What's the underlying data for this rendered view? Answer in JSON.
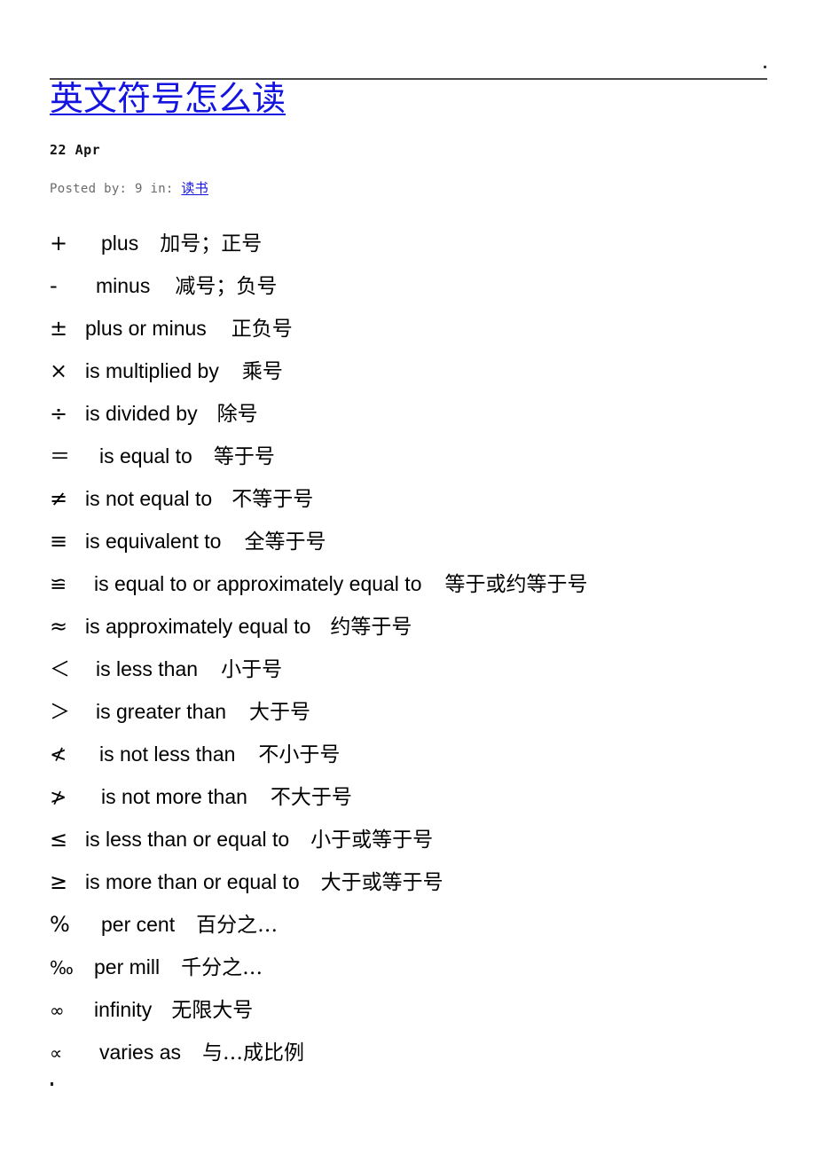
{
  "document": {
    "title": "英文符号怎么读",
    "date": "22 Apr",
    "meta_prefix": "Posted by: 9 in: ",
    "meta_category": "读书",
    "title_color": "#1414e0",
    "link_color": "#1414e0",
    "meta_color": "#6b6b6b",
    "rule_color": "#4a4a4a",
    "background": "#ffffff"
  },
  "symbols": [
    {
      "symbol": "+",
      "english": "plus",
      "chinese": "加号；正号"
    },
    {
      "symbol": "-",
      "english": "minus",
      "chinese": "减号；负号"
    },
    {
      "symbol": "±",
      "english": "plus or minus",
      "chinese": "正负号"
    },
    {
      "symbol": "×",
      "english": "is multiplied by",
      "chinese": "乘号"
    },
    {
      "symbol": "÷",
      "english": "is divided by",
      "chinese": "除号"
    },
    {
      "symbol": "＝",
      "english": "is equal to",
      "chinese": "等于号"
    },
    {
      "symbol": "≠",
      "english": "is not equal to",
      "chinese": "不等于号"
    },
    {
      "symbol": "≡",
      "english": "is equivalent to",
      "chinese": "全等于号"
    },
    {
      "symbol": "≌",
      "english": "is equal to or approximately equal to",
      "chinese": "等于或约等于号"
    },
    {
      "symbol": "≈",
      "english": "is approximately equal to",
      "chinese": "约等于号"
    },
    {
      "symbol": "＜",
      "english": "is less than",
      "chinese": "小于号"
    },
    {
      "symbol": "＞",
      "english": "is greater than",
      "chinese": "大于号"
    },
    {
      "symbol": "≮",
      "english": "is not less than",
      "chinese": "不小于号"
    },
    {
      "symbol": "≯",
      "english": "is not more than",
      "chinese": "不大于号"
    },
    {
      "symbol": "≤",
      "english": "is less than or equal to",
      "chinese": "小于或等于号"
    },
    {
      "symbol": "≥",
      "english": "is more than or equal to",
      "chinese": "大于或等于号"
    },
    {
      "symbol": "%",
      "english": "per cent",
      "chinese": "百分之…"
    },
    {
      "symbol": "‰",
      "english": "per mill",
      "chinese": "千分之…"
    },
    {
      "symbol": "∞",
      "english": "infinity",
      "chinese": "无限大号"
    },
    {
      "symbol": "∝",
      "english": "varies as",
      "chinese": "与…成比例"
    }
  ]
}
